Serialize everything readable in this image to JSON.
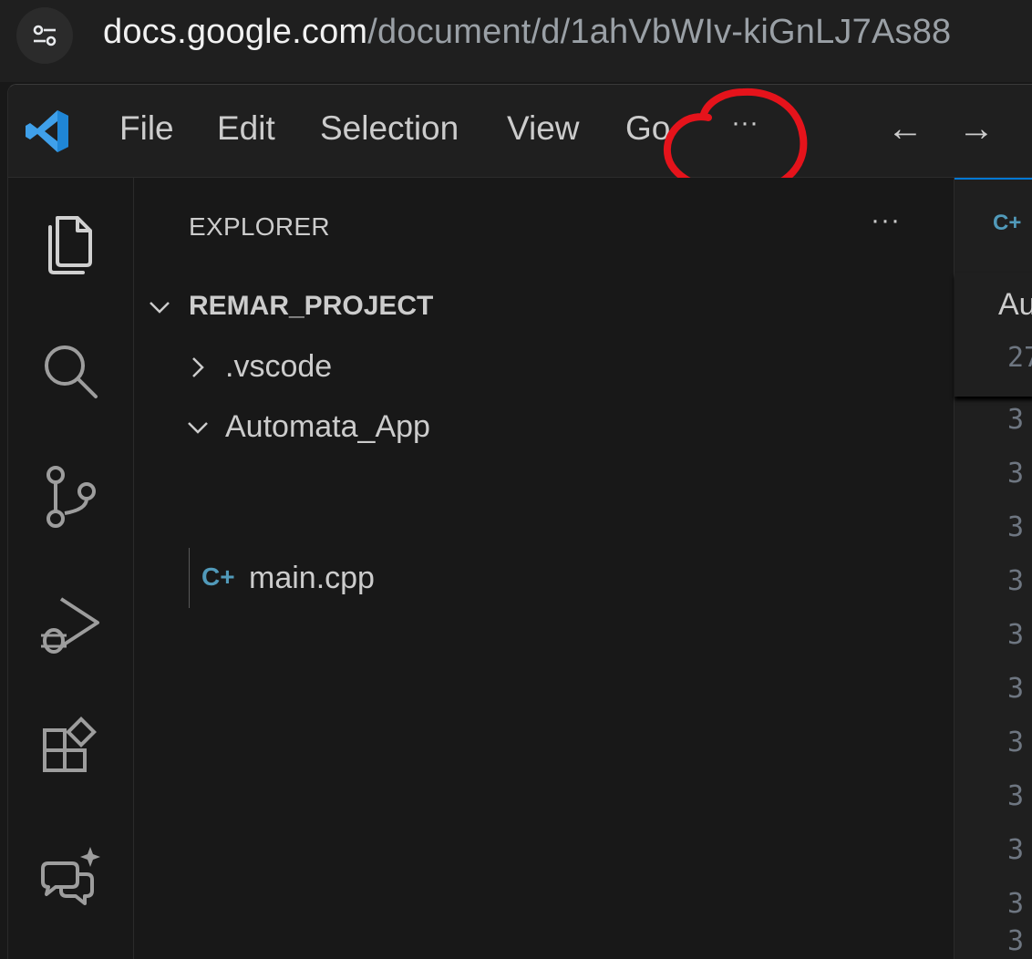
{
  "browser": {
    "url_host": "docs.google.com",
    "url_path": "/document/d/1ahVbWIv-kiGnLJ7As88"
  },
  "menu": {
    "items": [
      "File",
      "Edit",
      "Selection",
      "View",
      "Go"
    ],
    "more": "···",
    "back_arrow": "←",
    "forward_arrow": "→"
  },
  "sidebar": {
    "title": "EXPLORER",
    "more": "···",
    "project": "REMAR_PROJECT",
    "tree": [
      {
        "label": ".vscode",
        "type": "folder",
        "expanded": false
      },
      {
        "label": "Automata_App",
        "type": "folder",
        "expanded": true
      },
      {
        "label": "main.cpp",
        "type": "file"
      }
    ]
  },
  "editor": {
    "tab_icon": "C+",
    "breadcrumb": "Au",
    "sticky_line": "27",
    "line_numbers": [
      "3",
      "3",
      "3",
      "3",
      "3",
      "3",
      "3",
      "3",
      "3",
      "3",
      "3"
    ]
  },
  "colors": {
    "accent": "#0078d4",
    "cpp_icon": "#519aba",
    "annotation": "#e5131b"
  },
  "icons": [
    "files-icon",
    "search-icon",
    "source-control-icon",
    "run-debug-icon",
    "extensions-icon",
    "chat-icon"
  ]
}
